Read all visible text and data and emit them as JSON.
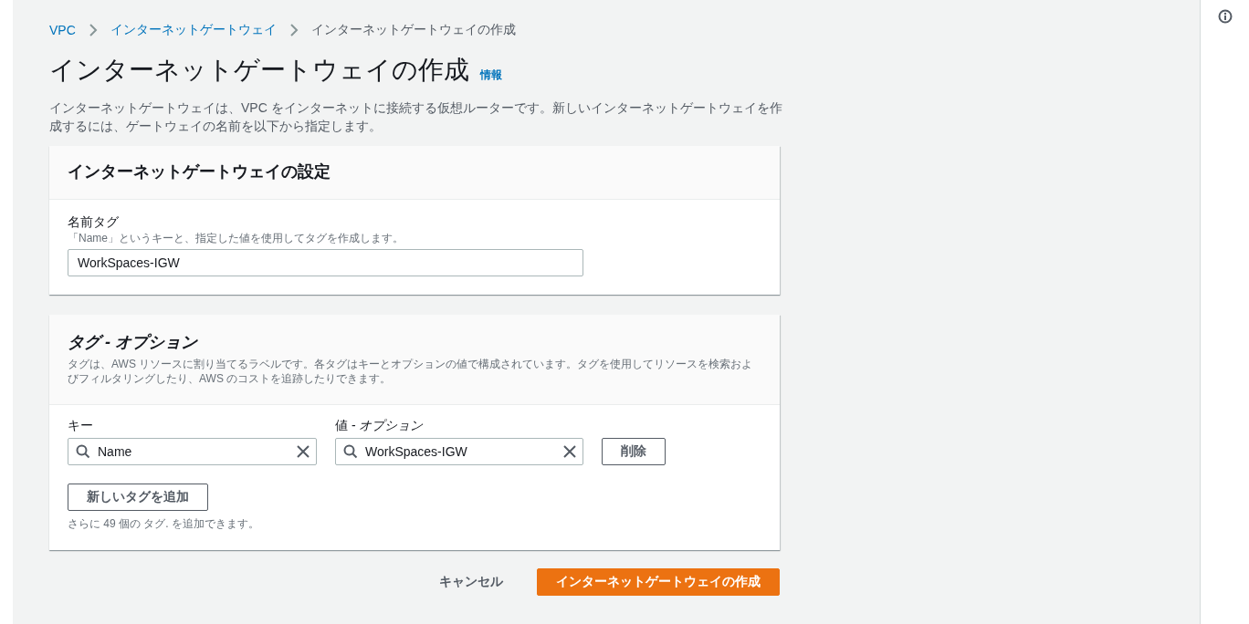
{
  "breadcrumb": [
    {
      "label": "VPC",
      "link": true
    },
    {
      "label": "インターネットゲートウェイ",
      "link": true
    },
    {
      "label": "インターネットゲートウェイの作成",
      "link": false
    }
  ],
  "page": {
    "title": "インターネットゲートウェイの作成",
    "info_link": "情報",
    "description": "インターネットゲートウェイは、VPC をインターネットに接続する仮想ルーターです。新しいインターネットゲートウェイを作成するには、ゲートウェイの名前を以下から指定します。"
  },
  "settings_panel": {
    "title": "インターネットゲートウェイの設定",
    "name_tag": {
      "label": "名前タグ",
      "hint": "「Name」というキーと、指定した値を使用してタグを作成します。",
      "value": "WorkSpaces-IGW"
    }
  },
  "tags_panel": {
    "title": "タグ - オプション",
    "description": "タグは、AWS リソースに割り当てるラベルです。各タグはキーとオプションの値で構成されています。タグを使用してリソースを検索およびフィルタリングしたり、AWS のコストを追跡したりできます。",
    "key_label": "キー",
    "value_label": "値 - *オプション*",
    "tags": [
      {
        "key": "Name",
        "value": "WorkSpaces-IGW",
        "remove_button": "削除"
      }
    ],
    "add_button": "新しいタグを追加",
    "remaining_note": "さらに 49 個の タグ. を追加できます。"
  },
  "actions": {
    "cancel": "キャンセル",
    "submit": "インターネットゲートウェイの作成"
  }
}
